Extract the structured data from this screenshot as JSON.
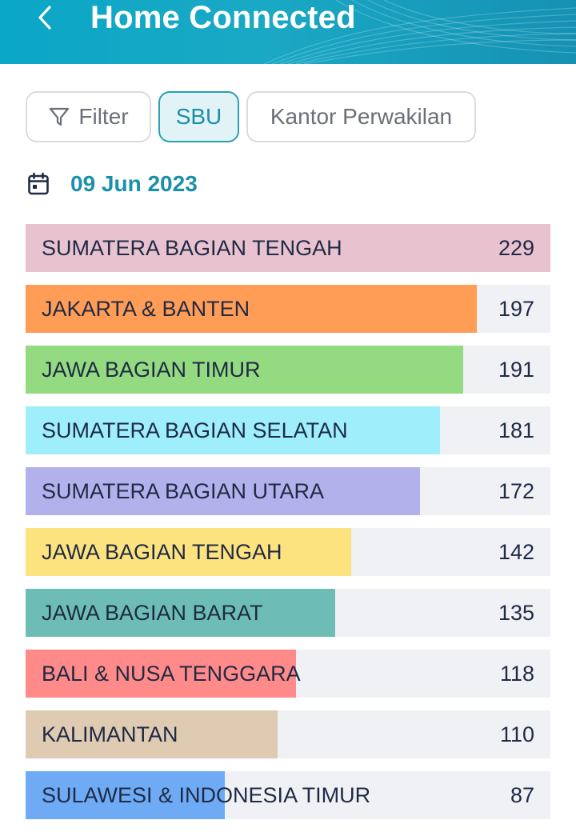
{
  "header": {
    "title": "Home Connected",
    "background": "#10a3c2"
  },
  "filters": [
    {
      "label": "Filter",
      "icon": "funnel-icon",
      "selected": false
    },
    {
      "label": "SBU",
      "selected": true
    },
    {
      "label": "Kantor Perwakilan",
      "selected": false
    }
  ],
  "date": {
    "icon": "calendar-icon",
    "text": "09 Jun 2023"
  },
  "chart_data": {
    "type": "bar",
    "orientation": "horizontal",
    "max_value": 229,
    "categories": [
      "SUMATERA BAGIAN TENGAH",
      "JAKARTA & BANTEN",
      "JAWA BAGIAN TIMUR",
      "SUMATERA BAGIAN SELATAN",
      "SUMATERA BAGIAN UTARA",
      "JAWA BAGIAN TENGAH",
      "JAWA BAGIAN BARAT",
      "BALI & NUSA TENGGARA",
      "KALIMANTAN",
      "SULAWESI & INDONESIA TIMUR"
    ],
    "values": [
      229,
      197,
      191,
      181,
      172,
      142,
      135,
      118,
      110,
      87
    ],
    "colors": [
      "#e9c2d0",
      "#ff9c56",
      "#93da80",
      "#9eeefb",
      "#b3b1ec",
      "#fde37f",
      "#6dbdb6",
      "#ff8a8a",
      "#dfcab2",
      "#6fabf5"
    ]
  }
}
